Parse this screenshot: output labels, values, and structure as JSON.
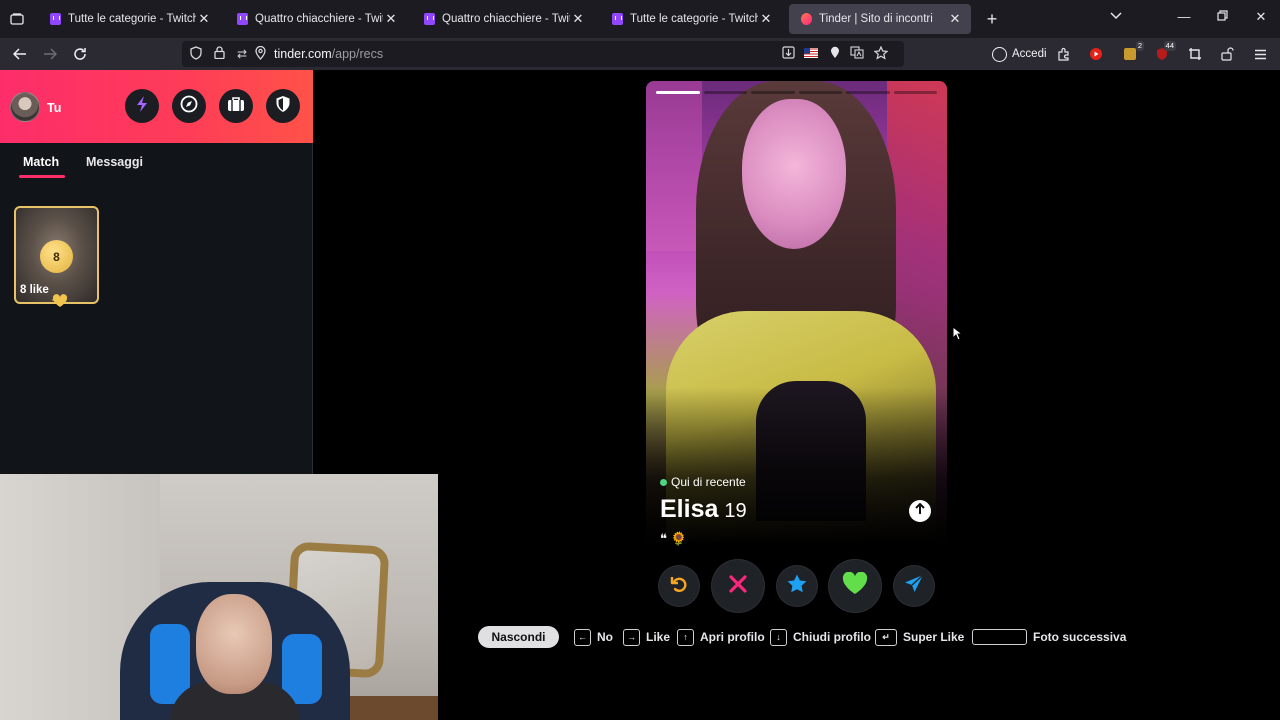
{
  "browser": {
    "tabs": [
      {
        "title": "Tutte le categorie - Twitch",
        "icon": "twitch-icon",
        "active": false
      },
      {
        "title": "Quattro chiacchiere - Twitch",
        "icon": "twitch-icon",
        "active": false
      },
      {
        "title": "Quattro chiacchiere - Twitch",
        "icon": "twitch-icon",
        "active": false
      },
      {
        "title": "Tutte le categorie - Twitch",
        "icon": "twitch-icon",
        "active": false
      },
      {
        "title": "Tinder | Sito di incontri",
        "icon": "tinder-icon",
        "active": true
      }
    ],
    "url_host": "tinder.com",
    "url_path": "/app/recs",
    "accedi_label": "Accedi",
    "extension_badges": {
      "ext1": "2",
      "ext2": "44"
    }
  },
  "sidebar": {
    "user_name": "Tu",
    "header_buttons": [
      "boost-icon",
      "explore-icon",
      "briefcase-icon",
      "shield-icon"
    ],
    "tabs": [
      {
        "label": "Match",
        "active": true
      },
      {
        "label": "Messaggi",
        "active": false
      }
    ],
    "likes": {
      "count": "8",
      "label": "8 like"
    }
  },
  "profile": {
    "status": "Qui di recente",
    "name": "Elisa",
    "age": "19",
    "bio_icons": "❝ 🌻",
    "photo_count": 6,
    "current_photo": 1
  },
  "actions": [
    "rewind-icon",
    "nope-icon",
    "super-like-icon",
    "like-icon",
    "boost-send-icon"
  ],
  "hints": {
    "hide_label": "Nascondi",
    "no": "No",
    "like": "Like",
    "open_profile": "Apri profilo",
    "close_profile": "Chiudi profilo",
    "super_like": "Super Like",
    "next_photo": "Foto successiva"
  },
  "colors": {
    "brand_gradient_start": "#fd2d6a",
    "brand_gradient_end": "#ff5248",
    "nope": "#fd267d",
    "super_like": "#1ea1f1",
    "like": "#62de4a",
    "rewind": "#f5a623",
    "send": "#1ea1f1"
  }
}
